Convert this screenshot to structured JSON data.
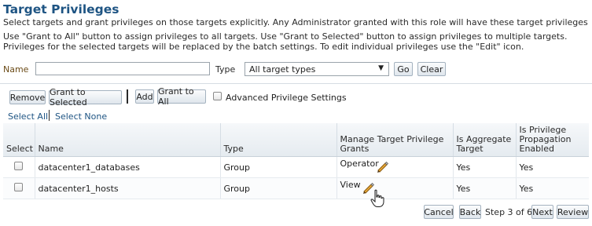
{
  "page": {
    "title": "Target Privileges",
    "desc1": "Select targets and grant privileges on those targets explicitly. Any Administrator granted with this role will have these target privileges",
    "desc2": "Use \"Grant to All\" button to assign privileges to all targets. Use \"Grant to Selected\" button to assign privileges to multiple targets. Privileges for the selected targets will be replaced by the batch settings. To edit individual privileges use the \"Edit\" icon."
  },
  "search": {
    "name_label": "Name",
    "name_value": "",
    "type_label": "Type",
    "type_value": "All target types",
    "go_label": "Go",
    "clear_label": "Clear"
  },
  "toolbar": {
    "remove_label": "Remove",
    "grant_selected_label": "Grant to Selected",
    "add_label": "Add",
    "grant_all_label": "Grant to All",
    "advanced_label": "Advanced Privilege Settings"
  },
  "selection": {
    "select_all": "Select All",
    "select_none": "Select None"
  },
  "table": {
    "headers": {
      "select": "Select",
      "name": "Name",
      "type": "Type",
      "grants": "Manage Target Privilege Grants",
      "aggregate": "Is Aggregate Target",
      "propagation": "Is Privilege Propagation Enabled"
    },
    "rows": [
      {
        "name": "datacenter1_databases",
        "type": "Group",
        "grants": "Operator",
        "aggregate": "Yes",
        "propagation": "Yes",
        "checked": false
      },
      {
        "name": "datacenter1_hosts",
        "type": "Group",
        "grants": "View",
        "aggregate": "Yes",
        "propagation": "Yes",
        "checked": false
      }
    ]
  },
  "footer": {
    "cancel_label": "Cancel",
    "back_label": "Back",
    "step_text": "Step 3 of 6",
    "next_label": "Next",
    "review_label": "Review"
  },
  "colors": {
    "title": "#1e5483",
    "link": "#1e5483",
    "header_bg": "#e5ebf0",
    "pencil": "#d99a1e"
  },
  "icons": {
    "edit": "pencil-icon",
    "cursor": "hand-cursor-icon",
    "dropdown": "chevron-down-icon"
  }
}
